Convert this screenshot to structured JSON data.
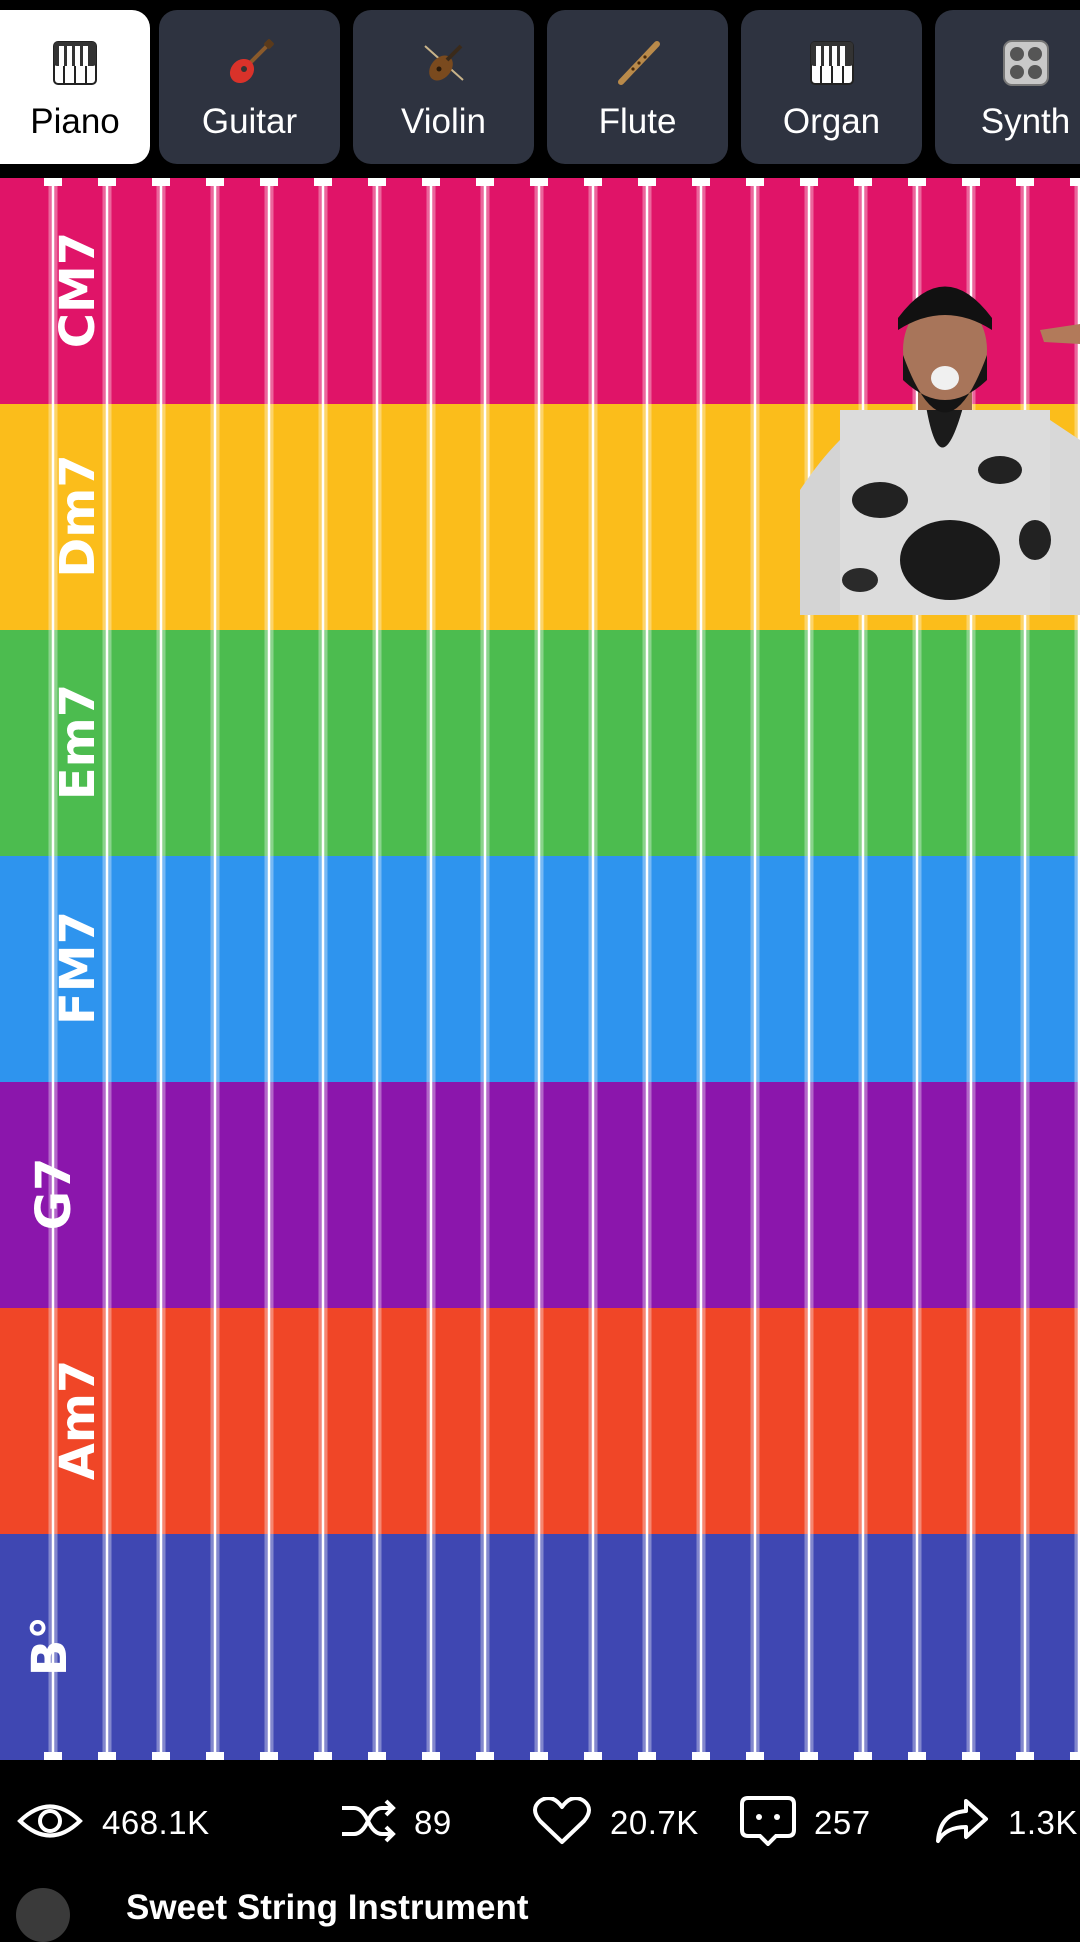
{
  "tabs": [
    {
      "label": "Piano",
      "icon": "piano-icon",
      "active": true
    },
    {
      "label": "Guitar",
      "icon": "guitar-icon",
      "active": false
    },
    {
      "label": "Violin",
      "icon": "violin-icon",
      "active": false
    },
    {
      "label": "Flute",
      "icon": "flute-icon",
      "active": false
    },
    {
      "label": "Organ",
      "icon": "organ-icon",
      "active": false
    },
    {
      "label": "Synth",
      "icon": "synth-icon",
      "active": false
    }
  ],
  "chords": [
    {
      "label": "CM7",
      "color": "#e01468"
    },
    {
      "label": "Dm7",
      "color": "#fbbd1b"
    },
    {
      "label": "Em7",
      "color": "#4cbc4f"
    },
    {
      "label": "FM7",
      "color": "#2e94ee"
    },
    {
      "label": "G7",
      "color": "#8b16ac"
    },
    {
      "label": "Am7",
      "color": "#f04627"
    },
    {
      "label": "B°",
      "color": "#3f47b2"
    }
  ],
  "stats": {
    "views": "468.1K",
    "remixes": "89",
    "likes": "20.7K",
    "comments": "257",
    "shares": "1.3K"
  },
  "video_title": "Sweet String Instrument"
}
